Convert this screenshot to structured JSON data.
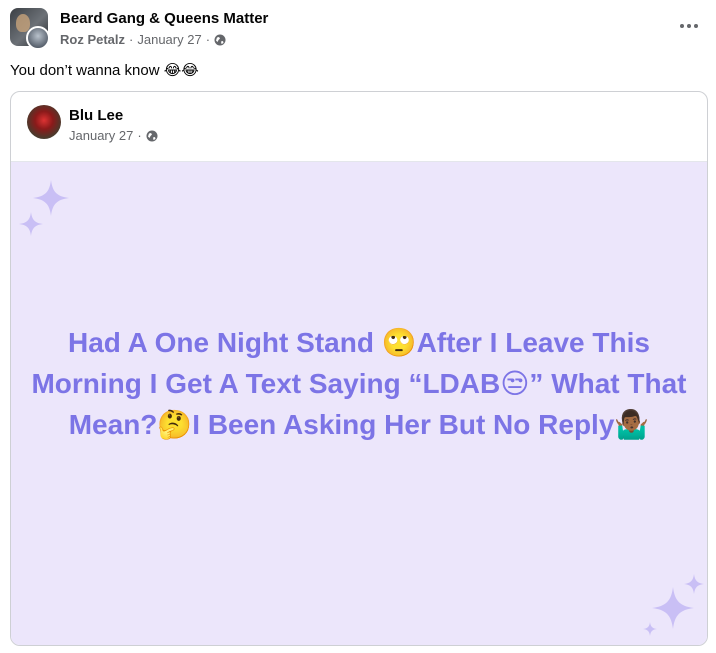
{
  "post": {
    "group_name": "Beard Gang & Queens Matter",
    "author": "Roz Petalz",
    "date": "January 27",
    "separator": "·",
    "text": "You don’t wanna know 😂😂"
  },
  "shared": {
    "author": "Blu Lee",
    "date": "January 27",
    "separator": "·",
    "background_color": "#ece6fb",
    "text_color": "#7c74e6",
    "text": "Had A One Night Stand 🙄After I Leave This Morning I Get A Text Saying “LDAB😒” What That Mean?🤔I Been Asking Her But No Reply🤷🏾‍♂️"
  },
  "icons": [
    "globe-icon",
    "more-options-icon",
    "sparkle-icon"
  ]
}
